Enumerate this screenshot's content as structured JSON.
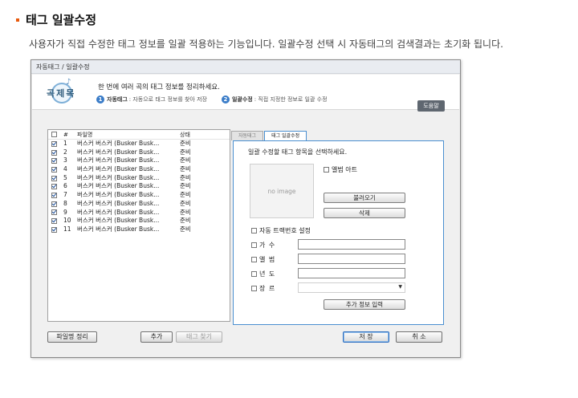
{
  "heading": "태그 일괄수정",
  "description": "사용자가 직접 수정한 태그 정보를 일괄 적용하는 기능입니다. 일괄수정 선택 시 자동태그의 검색결과는 초기화 됩니다.",
  "window": {
    "title": "자동태그 / 일괄수정",
    "banner": {
      "logo_text": "곡제목",
      "title": "한 번에 여러 곡의 태그 정보를 정리하세요.",
      "line1_num": "1",
      "line1_label": "자동태그",
      "line1_text": ": 자동으로 태그 정보를 찾아 저장",
      "line2_num": "2",
      "line2_label": "일괄수정",
      "line2_text": ": 직접 지정한 정보로 일괄 수정",
      "help_label": "도움말"
    },
    "list": {
      "col_num": "#",
      "col_name": "파일명",
      "col_status": "상태",
      "rows": [
        {
          "num": "1",
          "name": "버스커 버스커 (Busker Busk...",
          "status": "준비"
        },
        {
          "num": "2",
          "name": "버스커 버스커 (Busker Busk...",
          "status": "준비"
        },
        {
          "num": "3",
          "name": "버스커 버스커 (Busker Busk...",
          "status": "준비"
        },
        {
          "num": "4",
          "name": "버스커 버스커 (Busker Busk...",
          "status": "준비"
        },
        {
          "num": "5",
          "name": "버스커 버스커 (Busker Busk...",
          "status": "준비"
        },
        {
          "num": "6",
          "name": "버스커 버스커 (Busker Busk...",
          "status": "준비"
        },
        {
          "num": "7",
          "name": "버스커 버스커 (Busker Busk...",
          "status": "준비"
        },
        {
          "num": "8",
          "name": "버스커 버스커 (Busker Busk...",
          "status": "준비"
        },
        {
          "num": "9",
          "name": "버스커 버스커 (Busker Busk...",
          "status": "준비"
        },
        {
          "num": "10",
          "name": "버스커 버스커 (Busker Busk...",
          "status": "준비"
        },
        {
          "num": "11",
          "name": "버스커 버스커 (Busker Busk...",
          "status": "준비"
        }
      ]
    },
    "tabs": {
      "auto": "자동태그",
      "batch": "태그 일괄수정"
    },
    "panel": {
      "heading": "일괄 수정할 태그 항목을 선택하세요.",
      "no_image": "no image",
      "album_art": "앨범 아트",
      "load_button": "불러오기",
      "delete_button": "삭제",
      "track_number": "자동 트랙번호 설정",
      "artist_label": "가 수",
      "album_label": "앨 범",
      "year_label": "년 도",
      "genre_label": "장 르",
      "more_info_button": "추가 정보 입력"
    },
    "footer": {
      "filename_button": "파일명 정리",
      "add_button": "추가",
      "find_tag_button": "태그 찾기",
      "save_button": "저 장",
      "cancel_button": "취 소"
    }
  }
}
